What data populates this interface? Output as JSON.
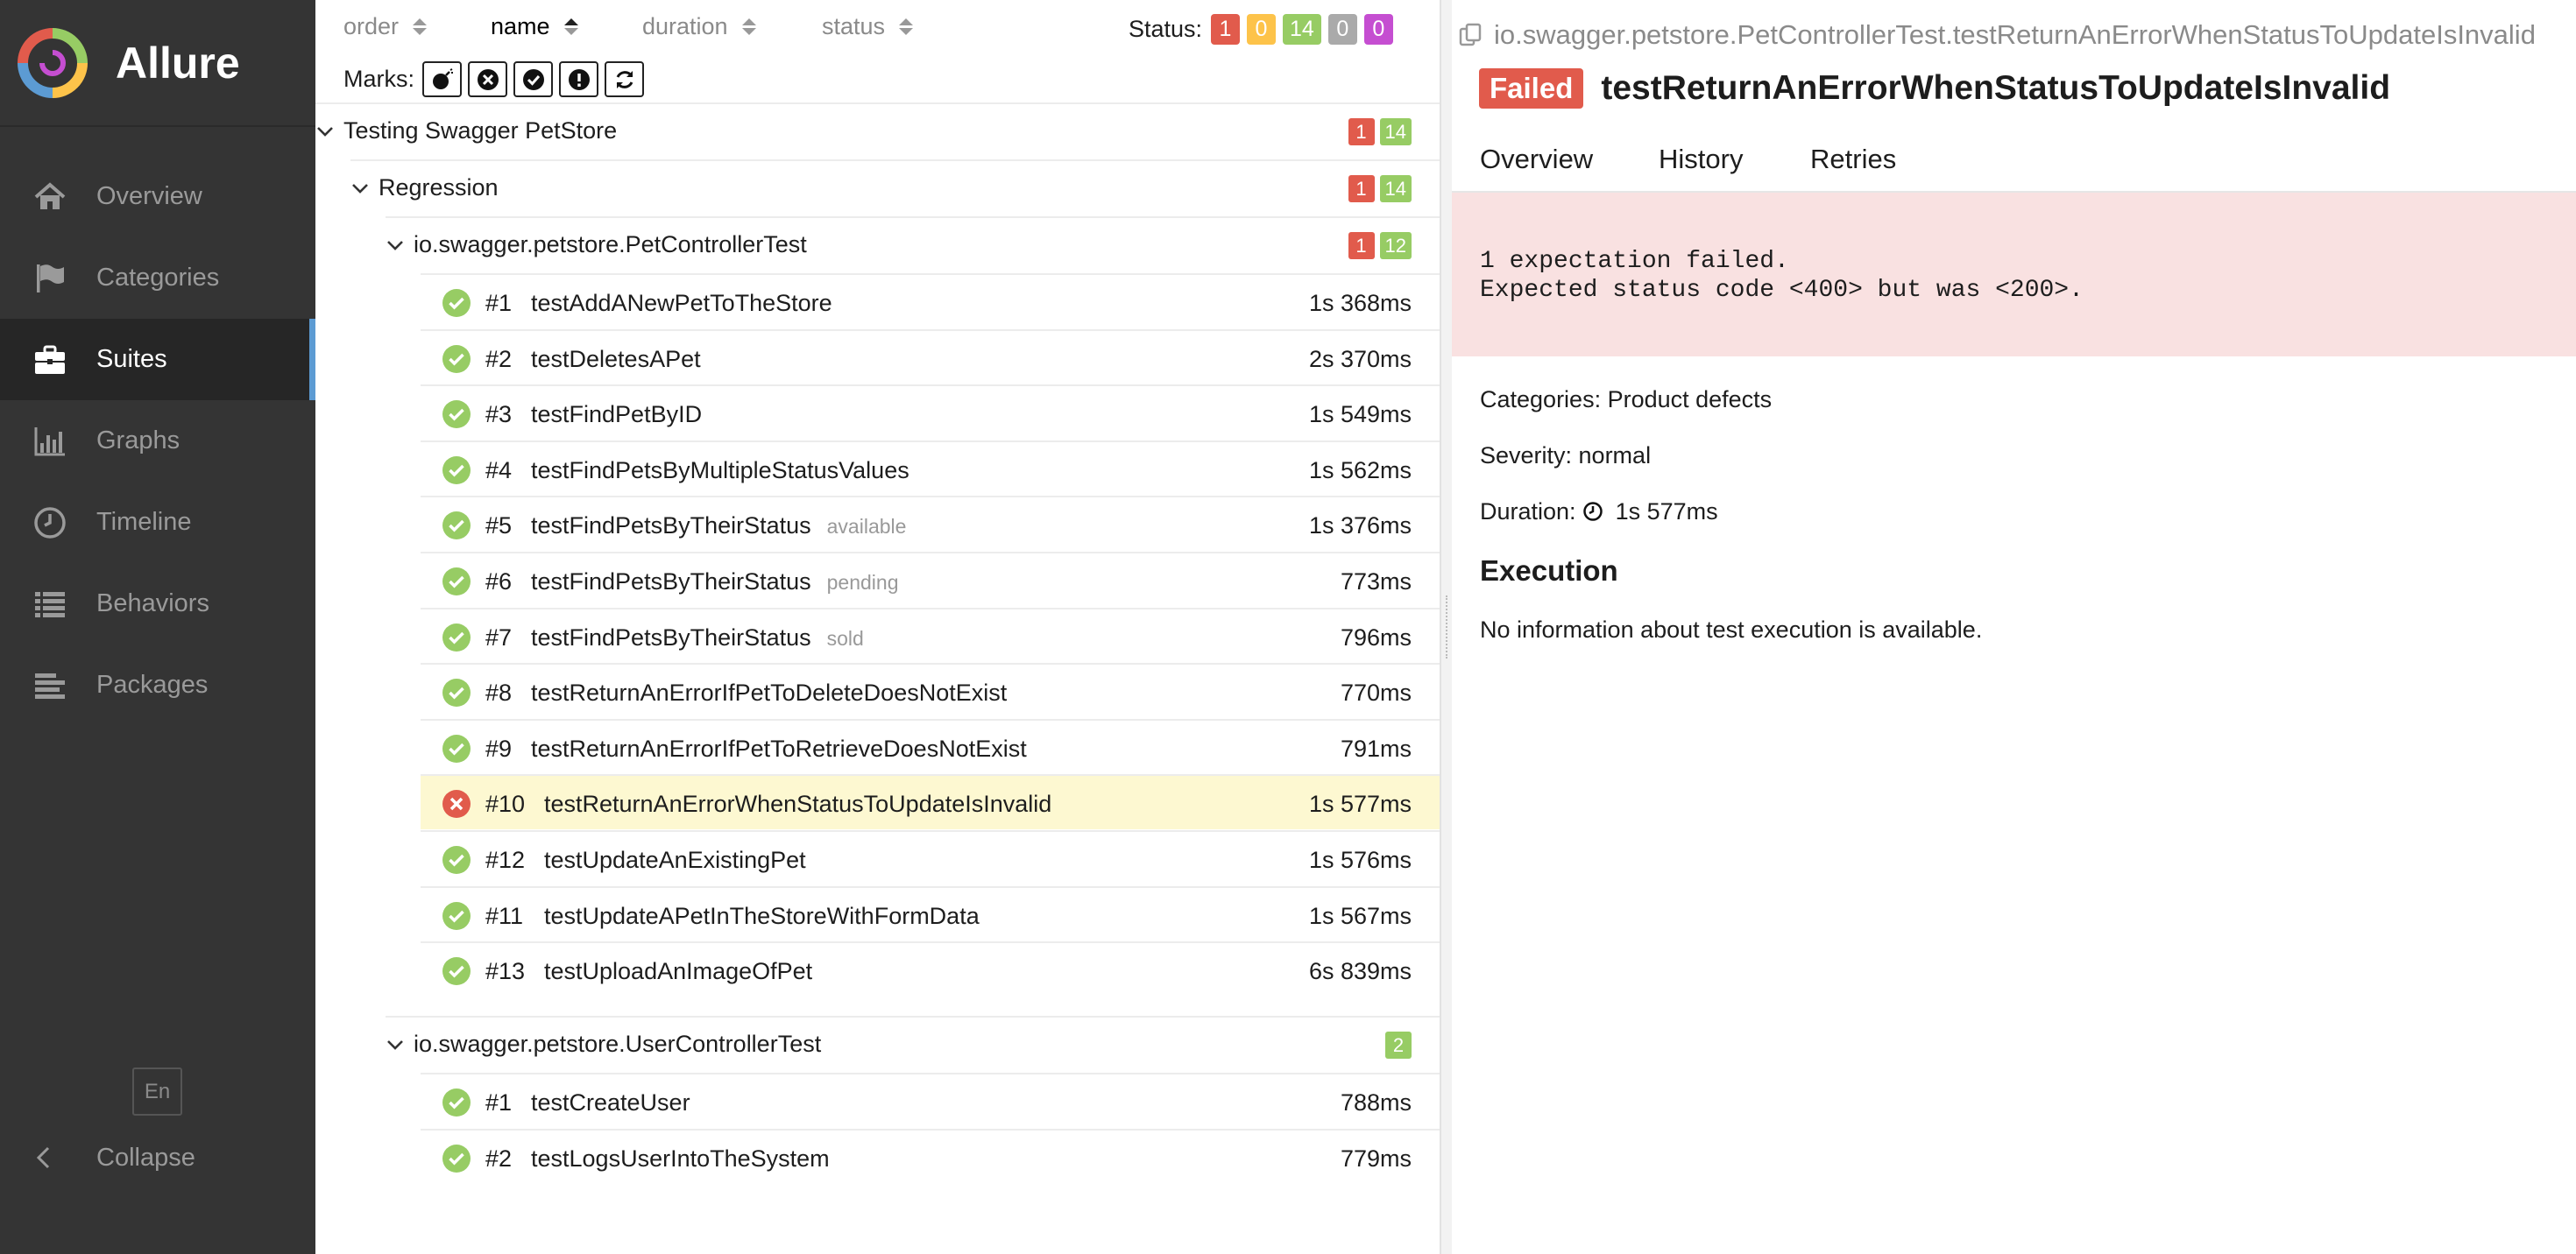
{
  "app": {
    "name": "Allure"
  },
  "sidebar": {
    "items": [
      {
        "label": "Overview",
        "icon": "home-icon"
      },
      {
        "label": "Categories",
        "icon": "flag-icon"
      },
      {
        "label": "Suites",
        "icon": "briefcase-icon",
        "active": true
      },
      {
        "label": "Graphs",
        "icon": "bar-chart-icon"
      },
      {
        "label": "Timeline",
        "icon": "clock-icon"
      },
      {
        "label": "Behaviors",
        "icon": "list-icon"
      },
      {
        "label": "Packages",
        "icon": "align-left-icon"
      }
    ],
    "language": "En",
    "collapse_label": "Collapse"
  },
  "tree": {
    "sort": {
      "order": "order",
      "name": "name",
      "duration": "duration",
      "status": "status"
    },
    "status_label": "Status:",
    "status_counts": {
      "failed": "1",
      "broken": "0",
      "passed": "14",
      "skipped": "0",
      "unknown": "0"
    },
    "marks_label": "Marks:",
    "suite": {
      "name": "Testing Swagger PetStore",
      "failed": "1",
      "passed": "14"
    },
    "subsuite": {
      "name": "Regression",
      "failed": "1",
      "passed": "14"
    },
    "pet_class": {
      "name": "io.swagger.petstore.PetControllerTest",
      "failed": "1",
      "passed": "12"
    },
    "pet_tests": [
      {
        "num": "#1",
        "name": "testAddANewPetToTheStore",
        "param": "",
        "duration": "1s 368ms",
        "status": "passed"
      },
      {
        "num": "#2",
        "name": "testDeletesAPet",
        "param": "",
        "duration": "2s 370ms",
        "status": "passed"
      },
      {
        "num": "#3",
        "name": "testFindPetByID",
        "param": "",
        "duration": "1s 549ms",
        "status": "passed"
      },
      {
        "num": "#4",
        "name": "testFindPetsByMultipleStatusValues",
        "param": "",
        "duration": "1s 562ms",
        "status": "passed"
      },
      {
        "num": "#5",
        "name": "testFindPetsByTheirStatus",
        "param": "available",
        "duration": "1s 376ms",
        "status": "passed"
      },
      {
        "num": "#6",
        "name": "testFindPetsByTheirStatus",
        "param": "pending",
        "duration": "773ms",
        "status": "passed"
      },
      {
        "num": "#7",
        "name": "testFindPetsByTheirStatus",
        "param": "sold",
        "duration": "796ms",
        "status": "passed"
      },
      {
        "num": "#8",
        "name": "testReturnAnErrorIfPetToDeleteDoesNotExist",
        "param": "",
        "duration": "770ms",
        "status": "passed"
      },
      {
        "num": "#9",
        "name": "testReturnAnErrorIfPetToRetrieveDoesNotExist",
        "param": "",
        "duration": "791ms",
        "status": "passed"
      },
      {
        "num": "#10",
        "name": "testReturnAnErrorWhenStatusToUpdateIsInvalid",
        "param": "",
        "duration": "1s 577ms",
        "status": "failed",
        "selected": true
      },
      {
        "num": "#12",
        "name": "testUpdateAnExistingPet",
        "param": "",
        "duration": "1s 576ms",
        "status": "passed"
      },
      {
        "num": "#11",
        "name": "testUpdateAPetInTheStoreWithFormData",
        "param": "",
        "duration": "1s 567ms",
        "status": "passed"
      },
      {
        "num": "#13",
        "name": "testUploadAnImageOfPet",
        "param": "",
        "duration": "6s 839ms",
        "status": "passed"
      }
    ],
    "user_class": {
      "name": "io.swagger.petstore.UserControllerTest",
      "passed": "2"
    },
    "user_tests": [
      {
        "num": "#1",
        "name": "testCreateUser",
        "param": "",
        "duration": "788ms",
        "status": "passed"
      },
      {
        "num": "#2",
        "name": "testLogsUserIntoTheSystem",
        "param": "",
        "duration": "779ms",
        "status": "passed"
      }
    ]
  },
  "details": {
    "full_name": "io.swagger.petstore.PetControllerTest.testReturnAnErrorWhenStatusToUpdateIsInvalid",
    "status_tag": "Failed",
    "name": "testReturnAnErrorWhenStatusToUpdateIsInvalid",
    "tabs": [
      "Overview",
      "History",
      "Retries"
    ],
    "error_message": "1 expectation failed.\nExpected status code <400> but was <200>.",
    "categories": "Categories: Product defects",
    "severity": "Severity: normal",
    "duration_label": "Duration:",
    "duration": "1s 577ms",
    "execution_title": "Execution",
    "execution_text": "No information about test execution is available."
  },
  "colors": {
    "failed": "#e15b4c",
    "broken": "#fdc34a",
    "passed": "#97cc64",
    "skipped": "#aaaaaa",
    "unknown": "#c54ed1",
    "sidebar_bg": "#343434",
    "accent": "#5c9bd3"
  }
}
